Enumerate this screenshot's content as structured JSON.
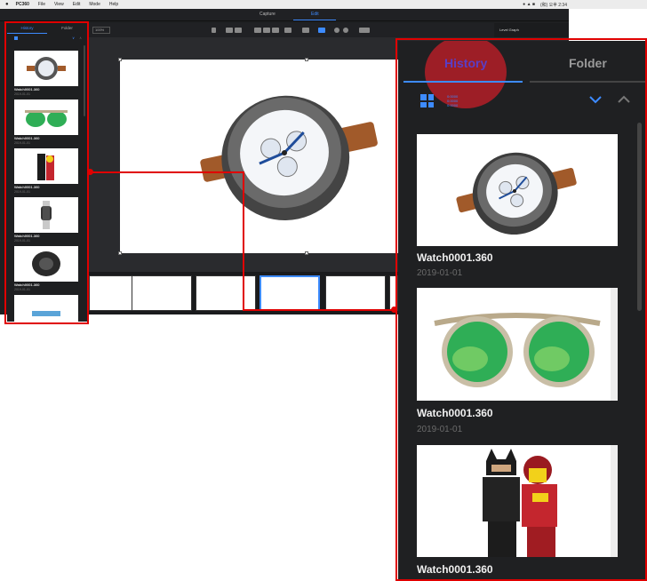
{
  "menubar": {
    "apple": "",
    "app_name": "PC360",
    "items": [
      "File",
      "View",
      "Edit",
      "Mode",
      "Help"
    ],
    "status": "(和) 오후 2:34"
  },
  "app": {
    "mode_tabs": [
      "Capture",
      "Edit"
    ],
    "active_mode": "Edit",
    "zoom_value": "100%",
    "right_panel_title": "Level Graph"
  },
  "sidebar": {
    "tabs": [
      "History",
      "Folder"
    ],
    "active_tab": "History",
    "items": [
      {
        "name": "Watch0001.360",
        "date": "2019-01-01"
      },
      {
        "name": "Watch0001.360",
        "date": "2019-01-01"
      },
      {
        "name": "Watch0001.360",
        "date": "2019-01-01"
      },
      {
        "name": "Watch0001.360",
        "date": "2019-01-01"
      },
      {
        "name": "Watch0001.360",
        "date": "2019-01-01"
      }
    ]
  },
  "zoom_panel": {
    "tabs": [
      "History",
      "Folder"
    ],
    "active_tab": "History",
    "tiny_labels": [
      "0:0000",
      "0:0000",
      "0:0000"
    ],
    "items": [
      {
        "name": "Watch0001.360",
        "date": "2019-01-01"
      },
      {
        "name": "Watch0001.360",
        "date": "2019-01-01"
      },
      {
        "name": "Watch0001.360",
        "date": ""
      }
    ]
  },
  "colors": {
    "accent": "#3d8bff",
    "highlight": "#e00000",
    "panel_bg": "#1f2022",
    "history_tab": "#5a3ec6"
  }
}
